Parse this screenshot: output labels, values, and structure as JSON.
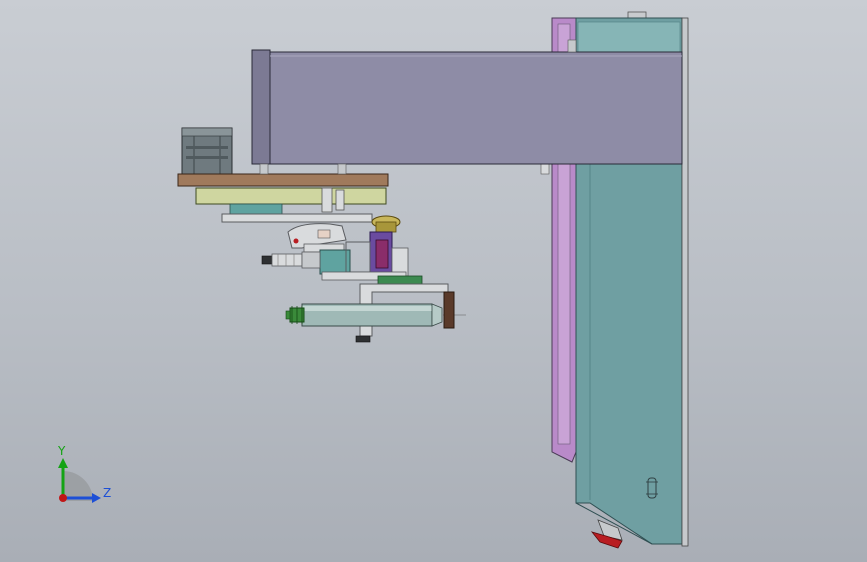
{
  "viewport": {
    "view_label": "3D model view",
    "colors": {
      "background_top": "#c9cdd3",
      "background_bottom": "#a9aeb6",
      "column_body": "#6f9fa2",
      "column_edge": "#4f7f82",
      "purple_rail": "#b98ac9",
      "arm_beam": "#8e8ca6",
      "arm_end": "#7c7a94",
      "mounting_plate": "#a07a5c",
      "green_bracket": "#cfd6a0",
      "teal_block": "#5fa3a0",
      "gray_part": "#d9dbdd",
      "gray_edge": "#5a5c60",
      "cylinder": "#9fb9b6",
      "green_knob": "#3a8a3a",
      "dark_brown": "#5a3a2a",
      "red_cap": "#b81d22",
      "purple_clamp": "#6a4ba0",
      "magenta_block": "#8a2d6a",
      "yellow_knob": "#c8b65a",
      "green_plate": "#3c8a50",
      "stepper_motor": "#6f7a7f"
    }
  },
  "triad": {
    "y_label": "Y",
    "z_label": "Z",
    "y_color": "#14a314",
    "z_color": "#1d4fd6",
    "origin_color": "#c01616"
  }
}
